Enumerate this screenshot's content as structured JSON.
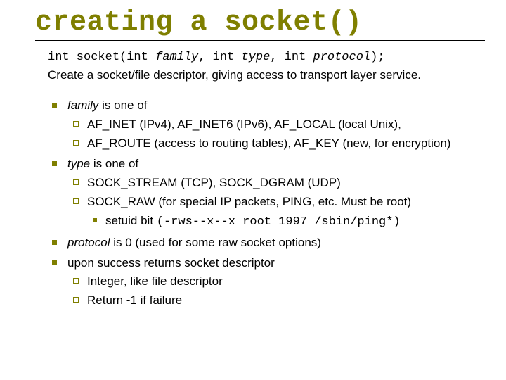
{
  "title": "creating a socket()",
  "signature": {
    "pre": "int socket(int ",
    "p1": "family",
    "mid1": ", int ",
    "p2": "type",
    "mid2": ", int ",
    "p3": "protocol",
    "post": ");"
  },
  "description": "Create a socket/file descriptor, giving access to transport layer service.",
  "b1": {
    "label_em": "family",
    "label_rest": " is one of",
    "sub": [
      "AF_INET (IPv4), AF_INET6 (IPv6), AF_LOCAL (local Unix),",
      "AF_ROUTE (access to routing tables), AF_KEY (new, for encryption)"
    ]
  },
  "b2": {
    "label_em": "type",
    "label_rest": " is one of",
    "sub1": "SOCK_STREAM (TCP), SOCK_DGRAM (UDP)",
    "sub2": "SOCK_RAW (for special IP packets, PING, etc.  Must be root)",
    "sub2_sub_lead": "setuid bit ",
    "sub2_sub_code": "(-rws--x--x root 1997 /sbin/ping*)"
  },
  "b3": {
    "label_em": "protocol",
    "label_rest": " is 0 (used for some raw socket options)"
  },
  "b4": {
    "label": "upon success returns socket descriptor",
    "sub": [
      "Integer, like file descriptor",
      "Return -1 if failure"
    ]
  }
}
